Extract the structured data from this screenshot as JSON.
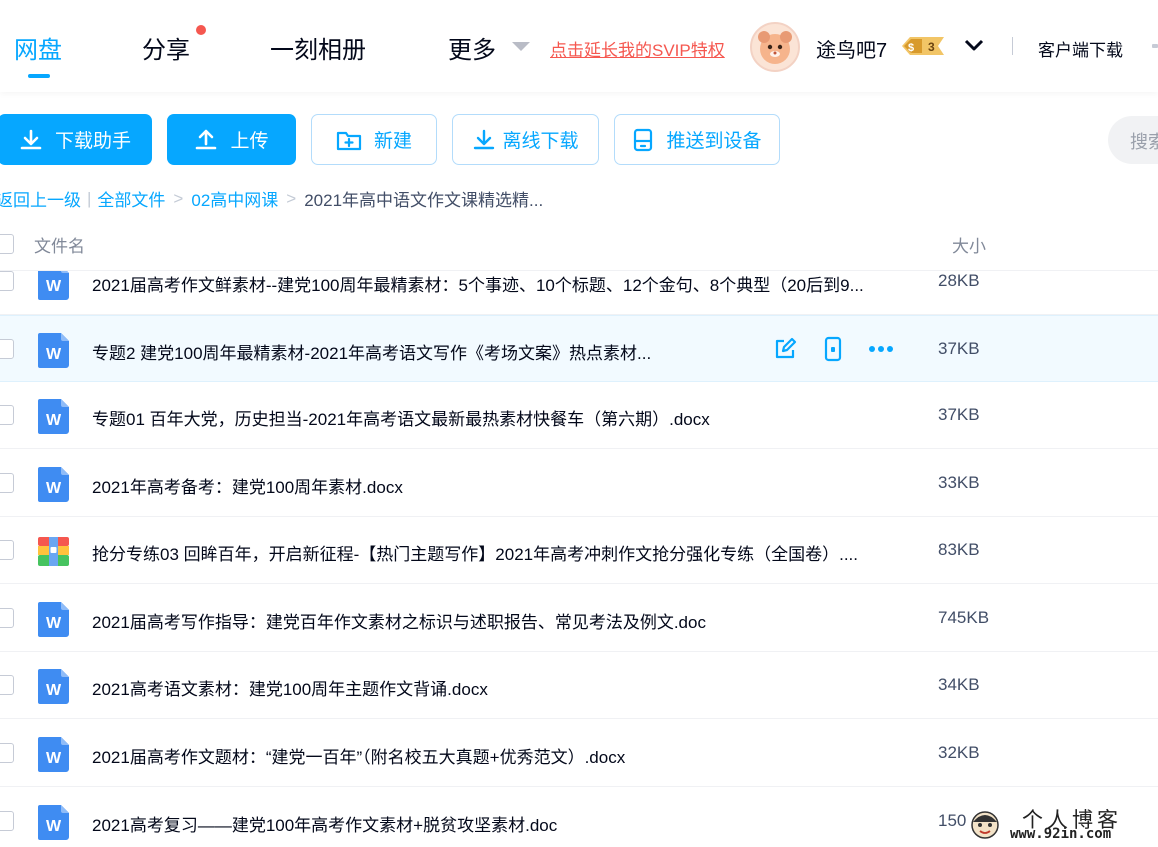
{
  "header": {
    "nav": [
      {
        "label": "网盘",
        "active": true
      },
      {
        "label": "分享",
        "has_notification": true
      },
      {
        "label": "一刻相册"
      },
      {
        "label": "更多"
      }
    ],
    "svip_link": "点击延长我的SVIP特权",
    "user": {
      "name": "途鸟吧7",
      "badge": "3",
      "badge_prefix": "$"
    },
    "client_download": "客户端下载"
  },
  "toolbar": {
    "download_helper": "下载助手",
    "upload": "上传",
    "new": "新建",
    "offline_download": "离线下载",
    "push_to_device": "推送到设备",
    "search_placeholder": "搜索"
  },
  "breadcrumb": {
    "back": "返回上一级",
    "all_files": "全部文件",
    "folder": "02高中网课",
    "current": "2021年高中语文作文课精选精..."
  },
  "table": {
    "col_name": "文件名",
    "col_size": "大小",
    "rows": [
      {
        "name": "2021届高考作文鲜素材--建党100周年最精素材：5个事迹、10个标题、12个金句、8个典型（20后到9...",
        "size": "28KB",
        "type": "word"
      },
      {
        "name": "专题2 建党100周年最精素材-2021年高考语文写作《考场文案》热点素材...",
        "size": "37KB",
        "type": "word",
        "hover": true
      },
      {
        "name": "专题01 百年大党，历史担当-2021年高考语文最新最热素材快餐车（第六期）.docx",
        "size": "37KB",
        "type": "word"
      },
      {
        "name": "2021年高考备考：建党100周年素材.docx",
        "size": "33KB",
        "type": "word"
      },
      {
        "name": "抢分专练03 回眸百年，开启新征程-【热门主题写作】2021年高考冲刺作文抢分强化专练（全国卷）....",
        "size": "83KB",
        "type": "archive"
      },
      {
        "name": "2021届高考写作指导：建党百年作文素材之标识与述职报告、常见考法及例文.doc",
        "size": "745KB",
        "type": "word"
      },
      {
        "name": "2021高考语文素材：建党100周年主题作文背诵.docx",
        "size": "34KB",
        "type": "word"
      },
      {
        "name": "2021届高考作文题材：“建党一百年”（附名校五大真题+优秀范文）.docx",
        "size": "32KB",
        "type": "word"
      },
      {
        "name": "2021高考复习——建党100年高考作文素材+脱贫攻坚素材.doc",
        "size": "150",
        "type": "word"
      }
    ]
  },
  "watermark": {
    "title": "个人博客",
    "url": "www.92in.com"
  },
  "colors": {
    "accent": "#06a7ff",
    "alert": "#f5574f",
    "text": "#03081a",
    "word_icon": "#3f8cf2"
  },
  "icons": [
    "download-icon",
    "upload-icon",
    "folder-plus-icon",
    "offline-download-icon",
    "device-icon",
    "edit-icon",
    "phone-icon",
    "more-icon",
    "word-file-icon",
    "archive-file-icon",
    "chevron-down-icon"
  ]
}
